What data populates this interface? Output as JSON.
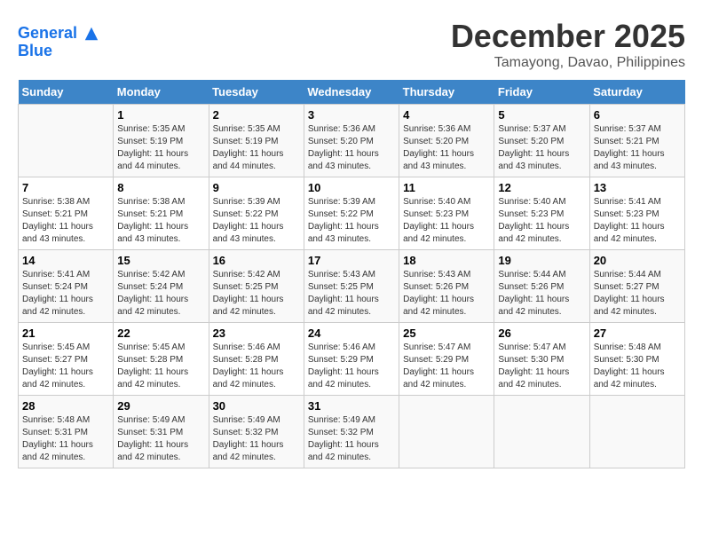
{
  "header": {
    "logo_line1": "General",
    "logo_line2": "Blue",
    "title": "December 2025",
    "subtitle": "Tamayong, Davao, Philippines"
  },
  "calendar": {
    "days_of_week": [
      "Sunday",
      "Monday",
      "Tuesday",
      "Wednesday",
      "Thursday",
      "Friday",
      "Saturday"
    ],
    "weeks": [
      [
        {
          "day": "",
          "info": ""
        },
        {
          "day": "1",
          "info": "Sunrise: 5:35 AM\nSunset: 5:19 PM\nDaylight: 11 hours\nand 44 minutes."
        },
        {
          "day": "2",
          "info": "Sunrise: 5:35 AM\nSunset: 5:19 PM\nDaylight: 11 hours\nand 44 minutes."
        },
        {
          "day": "3",
          "info": "Sunrise: 5:36 AM\nSunset: 5:20 PM\nDaylight: 11 hours\nand 43 minutes."
        },
        {
          "day": "4",
          "info": "Sunrise: 5:36 AM\nSunset: 5:20 PM\nDaylight: 11 hours\nand 43 minutes."
        },
        {
          "day": "5",
          "info": "Sunrise: 5:37 AM\nSunset: 5:20 PM\nDaylight: 11 hours\nand 43 minutes."
        },
        {
          "day": "6",
          "info": "Sunrise: 5:37 AM\nSunset: 5:21 PM\nDaylight: 11 hours\nand 43 minutes."
        }
      ],
      [
        {
          "day": "7",
          "info": "Sunrise: 5:38 AM\nSunset: 5:21 PM\nDaylight: 11 hours\nand 43 minutes."
        },
        {
          "day": "8",
          "info": "Sunrise: 5:38 AM\nSunset: 5:21 PM\nDaylight: 11 hours\nand 43 minutes."
        },
        {
          "day": "9",
          "info": "Sunrise: 5:39 AM\nSunset: 5:22 PM\nDaylight: 11 hours\nand 43 minutes."
        },
        {
          "day": "10",
          "info": "Sunrise: 5:39 AM\nSunset: 5:22 PM\nDaylight: 11 hours\nand 43 minutes."
        },
        {
          "day": "11",
          "info": "Sunrise: 5:40 AM\nSunset: 5:23 PM\nDaylight: 11 hours\nand 42 minutes."
        },
        {
          "day": "12",
          "info": "Sunrise: 5:40 AM\nSunset: 5:23 PM\nDaylight: 11 hours\nand 42 minutes."
        },
        {
          "day": "13",
          "info": "Sunrise: 5:41 AM\nSunset: 5:23 PM\nDaylight: 11 hours\nand 42 minutes."
        }
      ],
      [
        {
          "day": "14",
          "info": "Sunrise: 5:41 AM\nSunset: 5:24 PM\nDaylight: 11 hours\nand 42 minutes."
        },
        {
          "day": "15",
          "info": "Sunrise: 5:42 AM\nSunset: 5:24 PM\nDaylight: 11 hours\nand 42 minutes."
        },
        {
          "day": "16",
          "info": "Sunrise: 5:42 AM\nSunset: 5:25 PM\nDaylight: 11 hours\nand 42 minutes."
        },
        {
          "day": "17",
          "info": "Sunrise: 5:43 AM\nSunset: 5:25 PM\nDaylight: 11 hours\nand 42 minutes."
        },
        {
          "day": "18",
          "info": "Sunrise: 5:43 AM\nSunset: 5:26 PM\nDaylight: 11 hours\nand 42 minutes."
        },
        {
          "day": "19",
          "info": "Sunrise: 5:44 AM\nSunset: 5:26 PM\nDaylight: 11 hours\nand 42 minutes."
        },
        {
          "day": "20",
          "info": "Sunrise: 5:44 AM\nSunset: 5:27 PM\nDaylight: 11 hours\nand 42 minutes."
        }
      ],
      [
        {
          "day": "21",
          "info": "Sunrise: 5:45 AM\nSunset: 5:27 PM\nDaylight: 11 hours\nand 42 minutes."
        },
        {
          "day": "22",
          "info": "Sunrise: 5:45 AM\nSunset: 5:28 PM\nDaylight: 11 hours\nand 42 minutes."
        },
        {
          "day": "23",
          "info": "Sunrise: 5:46 AM\nSunset: 5:28 PM\nDaylight: 11 hours\nand 42 minutes."
        },
        {
          "day": "24",
          "info": "Sunrise: 5:46 AM\nSunset: 5:29 PM\nDaylight: 11 hours\nand 42 minutes."
        },
        {
          "day": "25",
          "info": "Sunrise: 5:47 AM\nSunset: 5:29 PM\nDaylight: 11 hours\nand 42 minutes."
        },
        {
          "day": "26",
          "info": "Sunrise: 5:47 AM\nSunset: 5:30 PM\nDaylight: 11 hours\nand 42 minutes."
        },
        {
          "day": "27",
          "info": "Sunrise: 5:48 AM\nSunset: 5:30 PM\nDaylight: 11 hours\nand 42 minutes."
        }
      ],
      [
        {
          "day": "28",
          "info": "Sunrise: 5:48 AM\nSunset: 5:31 PM\nDaylight: 11 hours\nand 42 minutes."
        },
        {
          "day": "29",
          "info": "Sunrise: 5:49 AM\nSunset: 5:31 PM\nDaylight: 11 hours\nand 42 minutes."
        },
        {
          "day": "30",
          "info": "Sunrise: 5:49 AM\nSunset: 5:32 PM\nDaylight: 11 hours\nand 42 minutes."
        },
        {
          "day": "31",
          "info": "Sunrise: 5:49 AM\nSunset: 5:32 PM\nDaylight: 11 hours\nand 42 minutes."
        },
        {
          "day": "",
          "info": ""
        },
        {
          "day": "",
          "info": ""
        },
        {
          "day": "",
          "info": ""
        }
      ]
    ]
  }
}
